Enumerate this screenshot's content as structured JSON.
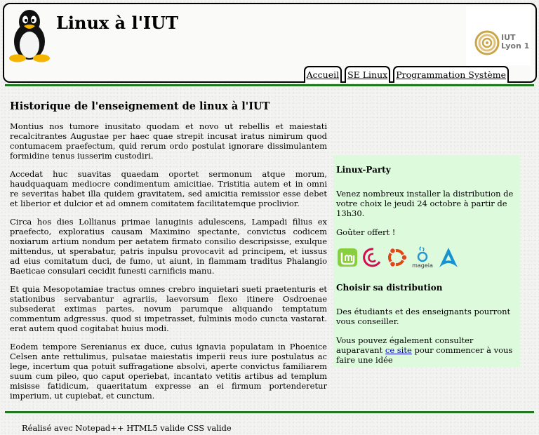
{
  "header": {
    "title": "Linux à l'IUT",
    "logo_text_line1": "IUT",
    "logo_text_line2": "Lyon 1"
  },
  "nav": {
    "tabs": [
      {
        "label": "Accueil"
      },
      {
        "label": "SE Linux"
      },
      {
        "label": "Programmation Système"
      }
    ]
  },
  "main": {
    "heading": "Historique de l'enseignement de linux à l'IUT",
    "paragraphs": [
      "Montius nos tumore inusitato quodam et novo ut rebellis et maiestati recalcitrantes Augustae per haec quae strepit incusat iratus nimirum quod contumacem praefectum, quid rerum ordo postulat ignorare dissimulantem formidine tenus iusserim custodiri.",
      "Accedat huc suavitas quaedam oportet sermonum atque morum, haudquaquam mediocre condimentum amicitiae. Tristitia autem et in omni re severitas habet illa quidem gravitatem, sed amicitia remissior esse debet et liberior et dulcior et ad omnem comitatem facilitatemque proclivior.",
      "Circa hos dies Lollianus primae lanuginis adulescens, Lampadi filius ex praefecto, exploratius causam Maximino spectante, convictus codicem noxiarum artium nondum per aetatem firmato consilio descripsisse, exulque mittendus, ut sperabatur, patris inpulsu provocavit ad principem, et iussus ad eius comitatum duci, de fumo, ut aiunt, in flammam traditus Phalangio Baeticae consulari cecidit funesti carnificis manu.",
      "Et quia Mesopotamiae tractus omnes crebro inquietari sueti praetenturis et stationibus servabantur agrariis, laevorsum flexo itinere Osdroenae subsederat extimas partes, novum parumque aliquando temptatum commentum adgressus. quod si impetrasset, fulminis modo cuncta vastarat. erat autem quod cogitabat huius modi.",
      "Eodem tempore Serenianus ex duce, cuius ignavia populatam in Phoenice Celsen ante rettulimus, pulsatae maiestatis imperii reus iure postulatus ac lege, incertum qua potuit suffragatione absolvi, aperte convictus familiarem suum cum pileo, quo caput operiebat, incantato vetitis artibus ad templum misisse fatidicum, quaeritatum expresse an ei firmum portenderetur imperium, ut cupiebat, et cunctum."
    ]
  },
  "aside": {
    "party_heading": "Linux-Party",
    "party_text": "Venez nombreux installer la distribution de votre choix le jeudi 24 octobre à partir de 13h30.",
    "snack_text": "Goûter offert !",
    "distros": [
      "linux-mint-icon",
      "debian-icon",
      "ubuntu-icon",
      "mageia-icon",
      "arch-linux-icon"
    ],
    "mageia_label": "mageia",
    "choose_heading": "Choisir sa distribution",
    "choose_text": "Des étudiants et des enseignants pourront vous conseiller.",
    "consult_prefix": "Vous pouvez également consulter auparavant",
    "consult_link": "ce site",
    "consult_suffix": "pour commencer à vous faire une idée"
  },
  "footer": {
    "text": "Réalisé avec Notepad++ HTML5 valide CSS valide"
  },
  "colors": {
    "rule_green": "#1f7a1f",
    "aside_bg": "#ddfadd",
    "link": "#0000cc"
  }
}
